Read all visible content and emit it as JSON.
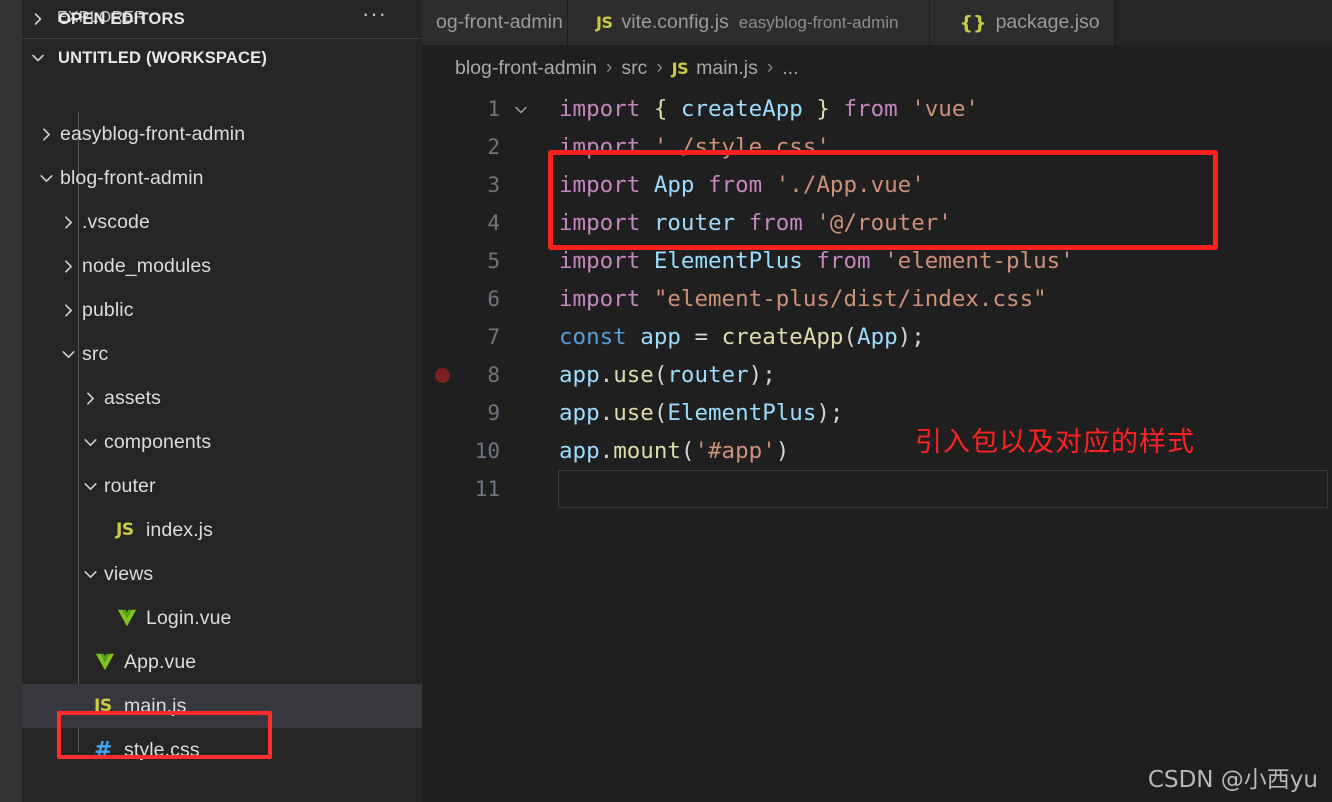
{
  "theme": {
    "activitybar_bg": "#333333",
    "sidebar_bg": "#252526",
    "editor_bg": "#1f1f1f",
    "tab_bg": "#2d2d2d",
    "selected_row_bg": "#37373d",
    "annotation_red": "#ff2020",
    "js_icon_yellow": "#cbcb41",
    "vue_icon_green": "#7fc41b",
    "css_icon_blue": "#42a5f5"
  },
  "sidebar": {
    "title": "EXPLORER",
    "more_actions": "···",
    "sections": [
      {
        "label": "OPEN EDITORS",
        "expanded": false,
        "twisty": "chevron-right-icon"
      },
      {
        "label": "UNTITLED (WORKSPACE)",
        "expanded": true,
        "twisty": "chevron-down-icon"
      }
    ],
    "tree": [
      {
        "label": "easyblog-front-admin",
        "kind": "folder",
        "expanded": false,
        "indent": 1,
        "icon": "chevron-right-icon"
      },
      {
        "label": "blog-front-admin",
        "kind": "folder",
        "expanded": true,
        "indent": 1,
        "icon": "chevron-down-icon"
      },
      {
        "label": ".vscode",
        "kind": "folder",
        "expanded": false,
        "indent": 2,
        "icon": "chevron-right-icon"
      },
      {
        "label": "node_modules",
        "kind": "folder",
        "expanded": false,
        "indent": 2,
        "icon": "chevron-right-icon"
      },
      {
        "label": "public",
        "kind": "folder",
        "expanded": false,
        "indent": 2,
        "icon": "chevron-right-icon"
      },
      {
        "label": "src",
        "kind": "folder",
        "expanded": true,
        "indent": 2,
        "icon": "chevron-down-icon"
      },
      {
        "label": "assets",
        "kind": "folder",
        "expanded": false,
        "indent": 3,
        "icon": "chevron-right-icon"
      },
      {
        "label": "components",
        "kind": "folder",
        "expanded": true,
        "indent": 3,
        "icon": "chevron-down-icon"
      },
      {
        "label": "router",
        "kind": "folder",
        "expanded": true,
        "indent": 3,
        "icon": "chevron-down-icon"
      },
      {
        "label": "index.js",
        "kind": "file",
        "file_icon": "js-file-icon",
        "icon_text": "JS",
        "indent": 4
      },
      {
        "label": "views",
        "kind": "folder",
        "expanded": true,
        "indent": 3,
        "icon": "chevron-down-icon"
      },
      {
        "label": "Login.vue",
        "kind": "file",
        "file_icon": "vue-file-icon",
        "icon_text": "V",
        "indent": 4
      },
      {
        "label": "App.vue",
        "kind": "file",
        "file_icon": "vue-file-icon",
        "icon_text": "V",
        "indent": 3
      },
      {
        "label": "main.js",
        "kind": "file",
        "file_icon": "js-file-icon",
        "icon_text": "JS",
        "indent": 3,
        "selected": true,
        "highlighted": true
      },
      {
        "label": "style.css",
        "kind": "file",
        "file_icon": "css-file-icon",
        "icon_text": "#",
        "indent": 3
      }
    ]
  },
  "tabs": [
    {
      "name": "og-front-admin",
      "description": "",
      "icon": "",
      "clipped_left": true,
      "active": false
    },
    {
      "name": "vite.config.js",
      "description": "easyblog-front-admin",
      "icon": "JS",
      "icon_kind": "js",
      "active": false
    },
    {
      "name": "package.jso",
      "description": "",
      "icon": "{}",
      "icon_kind": "json",
      "clipped_right": true,
      "active": false
    }
  ],
  "breadcrumb": {
    "items": [
      "blog-front-admin",
      "src",
      "main.js",
      "..."
    ],
    "file_icon": "JS",
    "separator": "›"
  },
  "code": {
    "lines": [
      {
        "num": "1",
        "fold": "chevron-down-icon",
        "tokens": [
          {
            "t": "import",
            "c": "t-kw"
          },
          {
            "t": " ",
            "c": "t-plain"
          },
          {
            "t": "{",
            "c": "t-brace"
          },
          {
            "t": " ",
            "c": "t-plain"
          },
          {
            "t": "createApp",
            "c": "t-var"
          },
          {
            "t": " ",
            "c": "t-plain"
          },
          {
            "t": "}",
            "c": "t-brace"
          },
          {
            "t": " ",
            "c": "t-plain"
          },
          {
            "t": "from",
            "c": "t-kw"
          },
          {
            "t": " ",
            "c": "t-plain"
          },
          {
            "t": "'vue'",
            "c": "t-str"
          }
        ]
      },
      {
        "num": "2",
        "tokens": [
          {
            "t": "import",
            "c": "t-kw"
          },
          {
            "t": " ",
            "c": "t-plain"
          },
          {
            "t": "'./style.css'",
            "c": "t-str"
          }
        ]
      },
      {
        "num": "3",
        "tokens": [
          {
            "t": "import",
            "c": "t-kw"
          },
          {
            "t": " ",
            "c": "t-plain"
          },
          {
            "t": "App",
            "c": "t-var"
          },
          {
            "t": " ",
            "c": "t-plain"
          },
          {
            "t": "from",
            "c": "t-kw"
          },
          {
            "t": " ",
            "c": "t-plain"
          },
          {
            "t": "'./App.vue'",
            "c": "t-str"
          }
        ]
      },
      {
        "num": "4",
        "tokens": [
          {
            "t": "import",
            "c": "t-kw"
          },
          {
            "t": " ",
            "c": "t-plain"
          },
          {
            "t": "router",
            "c": "t-var"
          },
          {
            "t": " ",
            "c": "t-plain"
          },
          {
            "t": "from",
            "c": "t-kw"
          },
          {
            "t": " ",
            "c": "t-plain"
          },
          {
            "t": "'@/router'",
            "c": "t-str"
          }
        ]
      },
      {
        "num": "5",
        "highlighted": true,
        "tokens": [
          {
            "t": "import",
            "c": "t-kw"
          },
          {
            "t": " ",
            "c": "t-plain"
          },
          {
            "t": "ElementPlus",
            "c": "t-var"
          },
          {
            "t": " ",
            "c": "t-plain"
          },
          {
            "t": "from",
            "c": "t-kw"
          },
          {
            "t": " ",
            "c": "t-plain"
          },
          {
            "t": "'element-plus'",
            "c": "t-str"
          }
        ]
      },
      {
        "num": "6",
        "highlighted": true,
        "tokens": [
          {
            "t": "import",
            "c": "t-kw"
          },
          {
            "t": " ",
            "c": "t-plain"
          },
          {
            "t": "\"element-plus/dist/index.css\"",
            "c": "t-str"
          }
        ]
      },
      {
        "num": "7",
        "tokens": [
          {
            "t": "const",
            "c": "t-const"
          },
          {
            "t": " ",
            "c": "t-plain"
          },
          {
            "t": "app",
            "c": "t-var"
          },
          {
            "t": " ",
            "c": "t-plain"
          },
          {
            "t": "=",
            "c": "t-plain"
          },
          {
            "t": " ",
            "c": "t-plain"
          },
          {
            "t": "createApp",
            "c": "t-fn"
          },
          {
            "t": "(",
            "c": "t-plain"
          },
          {
            "t": "App",
            "c": "t-var"
          },
          {
            "t": ");",
            "c": "t-plain"
          }
        ]
      },
      {
        "num": "8",
        "breakpoint": true,
        "tokens": [
          {
            "t": "app",
            "c": "t-var"
          },
          {
            "t": ".",
            "c": "t-plain"
          },
          {
            "t": "use",
            "c": "t-fn"
          },
          {
            "t": "(",
            "c": "t-plain"
          },
          {
            "t": "router",
            "c": "t-var"
          },
          {
            "t": ");",
            "c": "t-plain"
          }
        ]
      },
      {
        "num": "9",
        "tokens": [
          {
            "t": "app",
            "c": "t-var"
          },
          {
            "t": ".",
            "c": "t-plain"
          },
          {
            "t": "use",
            "c": "t-fn"
          },
          {
            "t": "(",
            "c": "t-plain"
          },
          {
            "t": "ElementPlus",
            "c": "t-var"
          },
          {
            "t": ");",
            "c": "t-plain"
          }
        ]
      },
      {
        "num": "10",
        "tokens": [
          {
            "t": "app",
            "c": "t-var"
          },
          {
            "t": ".",
            "c": "t-plain"
          },
          {
            "t": "mount",
            "c": "t-fn"
          },
          {
            "t": "(",
            "c": "t-plain"
          },
          {
            "t": "'#app'",
            "c": "t-str"
          },
          {
            "t": ")",
            "c": "t-plain"
          }
        ]
      },
      {
        "num": "11",
        "cursor_line": true,
        "tokens": []
      }
    ]
  },
  "annotations": {
    "chinese_note": "引入包以及对应的样式"
  },
  "watermark": "CSDN @小西yu"
}
